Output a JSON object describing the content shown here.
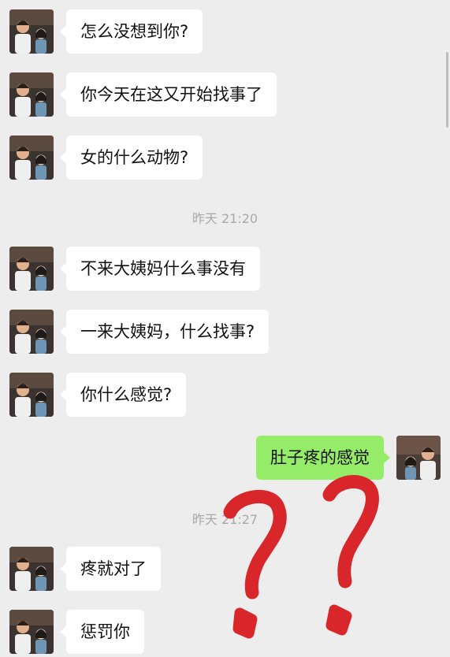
{
  "messages": [
    {
      "side": "left",
      "text": "怎么没想到你?"
    },
    {
      "side": "left",
      "text": "你今天在这又开始找事了"
    },
    {
      "side": "left",
      "text": "女的什么动物?"
    },
    {
      "side": "left",
      "text": "不来大姨妈什么事没有"
    },
    {
      "side": "left",
      "text": "一来大姨妈，什么找事?"
    },
    {
      "side": "left",
      "text": "你什么感觉?"
    },
    {
      "side": "right",
      "text": "肚子疼的感觉"
    },
    {
      "side": "left",
      "text": "疼就对了"
    },
    {
      "side": "left",
      "text": "惩罚你"
    }
  ],
  "timestamps": [
    {
      "text": "昨天 21:20"
    },
    {
      "text": "昨天 21:27"
    }
  ],
  "overlay": {
    "marks": "??",
    "color": "#d8262a",
    "icon": "hand-drawn-question-marks"
  },
  "colors": {
    "background": "#ededed",
    "bubble_left": "#ffffff",
    "bubble_right": "#95ec69"
  }
}
